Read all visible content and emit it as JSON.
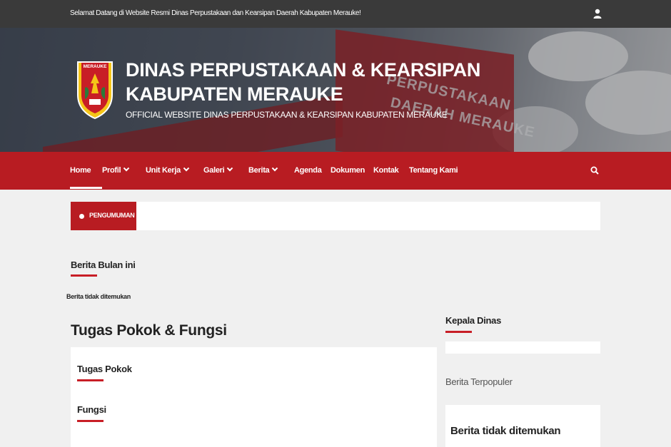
{
  "topbar": {
    "welcome": "Selamat Datang di Website Resmi Dinas Perpustakaan dan Kearsipan Daerah Kabupaten Merauke!",
    "user_icon": "user-icon"
  },
  "header": {
    "logo_text": "MERAUKE",
    "title_line1": "DINAS PERPUSTAKAAN & KEARSIPAN",
    "title_line2": "KABUPATEN MERAUKE",
    "subtitle": "OFFICIAL WEBSITE DINAS PERPUSTAKAAN & KEARSIPAN KABUPATEN MERAUKE",
    "building_line1": "PERPUSTAKAAN",
    "building_line2": "DAERAH MERAUKE"
  },
  "nav": {
    "items": [
      {
        "label": "Home"
      },
      {
        "label": "Profil"
      },
      {
        "label": "Unit Kerja"
      },
      {
        "label": "Galeri"
      },
      {
        "label": "Berita"
      },
      {
        "label": "Agenda"
      },
      {
        "label": "Dokumen"
      },
      {
        "label": "Kontak"
      },
      {
        "label": "Tentang Kami"
      }
    ],
    "search_icon": "search-icon"
  },
  "announcement": {
    "label": "PENGUMUMAN"
  },
  "main": {
    "month_news_title": "Berita Bulan ini",
    "month_news_empty": "Berita tidak ditemukan",
    "tupoksi_title": "Tugas Pokok & Fungsi",
    "tupoksi_items": [
      "Tugas Pokok",
      "Fungsi"
    ]
  },
  "sidebar": {
    "head_title": "Kepala Dinas",
    "popular_title": "Berita Terpopuler",
    "popular_empty": "Berita tidak ditemukan"
  },
  "colors": {
    "brand_red": "#b81c22",
    "topbar": "#3a3a3a",
    "background": "#f0f0f0"
  }
}
